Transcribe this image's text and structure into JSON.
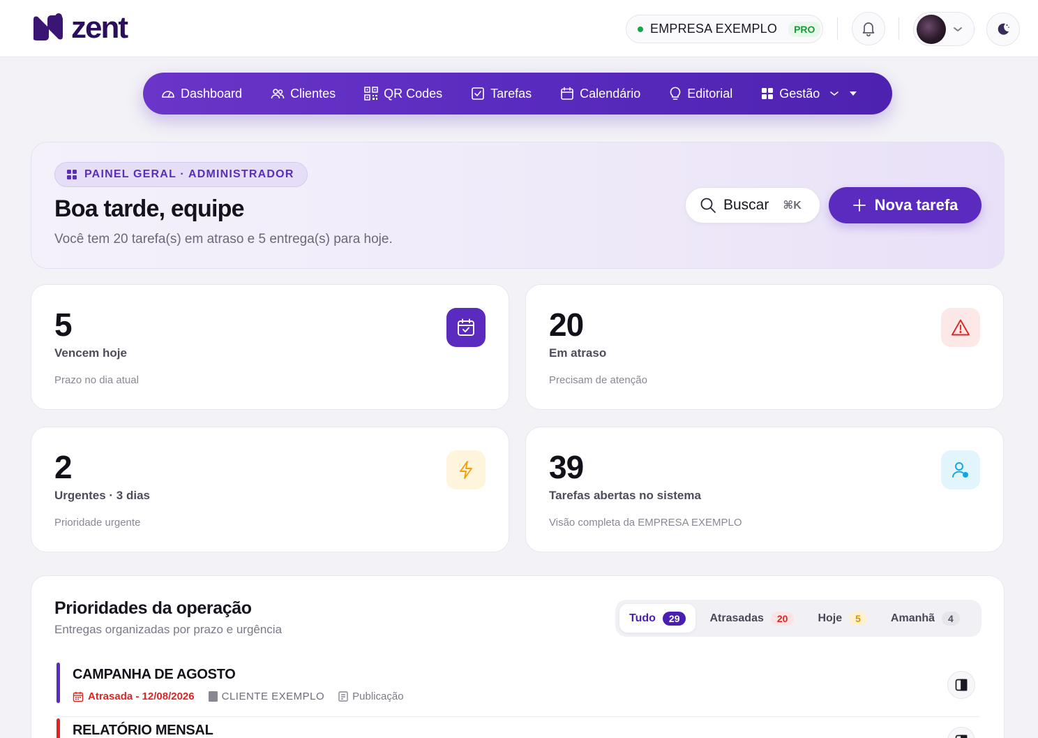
{
  "brand": {
    "name": "zent",
    "color": "#2b0e5c"
  },
  "header": {
    "company": "EMPRESA EXEMPLO",
    "plan_badge": "PRO",
    "notification_icon": "bell-icon",
    "avatar_icon": "avatar",
    "theme_icon": "moon-icon"
  },
  "nav": {
    "items": [
      {
        "label": "Dashboard",
        "icon": "gauge-icon"
      },
      {
        "label": "Clientes",
        "icon": "users-icon"
      },
      {
        "label": "QR Codes",
        "icon": "qr-code-icon"
      },
      {
        "label": "Tarefas",
        "icon": "checkbox-icon"
      },
      {
        "label": "Calendário",
        "icon": "calendar-icon"
      },
      {
        "label": "Editorial",
        "icon": "lightbulb-icon"
      },
      {
        "label": "Gestão",
        "icon": "grid-icon"
      }
    ]
  },
  "hero": {
    "badge": "PAINEL GERAL · ADMINISTRADOR",
    "title": "Boa tarde, equipe",
    "subtitle": "Você tem 20 tarefa(s) em atraso e 5 entrega(s) para hoje.",
    "search_label": "Buscar",
    "search_shortcut": "⌘K",
    "new_task_label": "Nova tarefa"
  },
  "stats": [
    {
      "value": "5",
      "label": "Vencem hoje",
      "sub": "Prazo no dia atual",
      "icon": "calendar-check-icon"
    },
    {
      "value": "20",
      "label": "Em atraso",
      "sub": "Precisam de atenção",
      "icon": "warning-icon"
    },
    {
      "value": "2",
      "label": "Urgentes · 3 dias",
      "sub": "Prioridade urgente",
      "icon": "lightning-icon"
    },
    {
      "value": "39",
      "label": "Tarefas abertas no sistema",
      "sub": "Visão completa da EMPRESA EXEMPLO",
      "icon": "user-status-icon"
    }
  ],
  "priorities": {
    "title": "Prioridades da operação",
    "subtitle": "Entregas organizadas por prazo e urgência",
    "filters": [
      {
        "label": "Tudo",
        "count": "29"
      },
      {
        "label": "Atrasadas",
        "count": "20"
      },
      {
        "label": "Hoje",
        "count": "5"
      },
      {
        "label": "Amanhã",
        "count": "4"
      }
    ],
    "tasks": [
      {
        "title": "CAMPANHA DE AGOSTO",
        "status": "Atrasada - 12/08/2026",
        "client": "CLIENTE EXEMPLO",
        "type": "Publicação",
        "accent": "#5b2bc0"
      },
      {
        "title": "RELATÓRIO MENSAL",
        "status": "",
        "client": "",
        "type": "",
        "accent": "#e02424"
      }
    ]
  },
  "colors": {
    "primary": "#5b2bc0",
    "danger": "#dc2626",
    "warning": "#f59e0b",
    "info": "#0ea5e9",
    "success": "#16a34a"
  }
}
